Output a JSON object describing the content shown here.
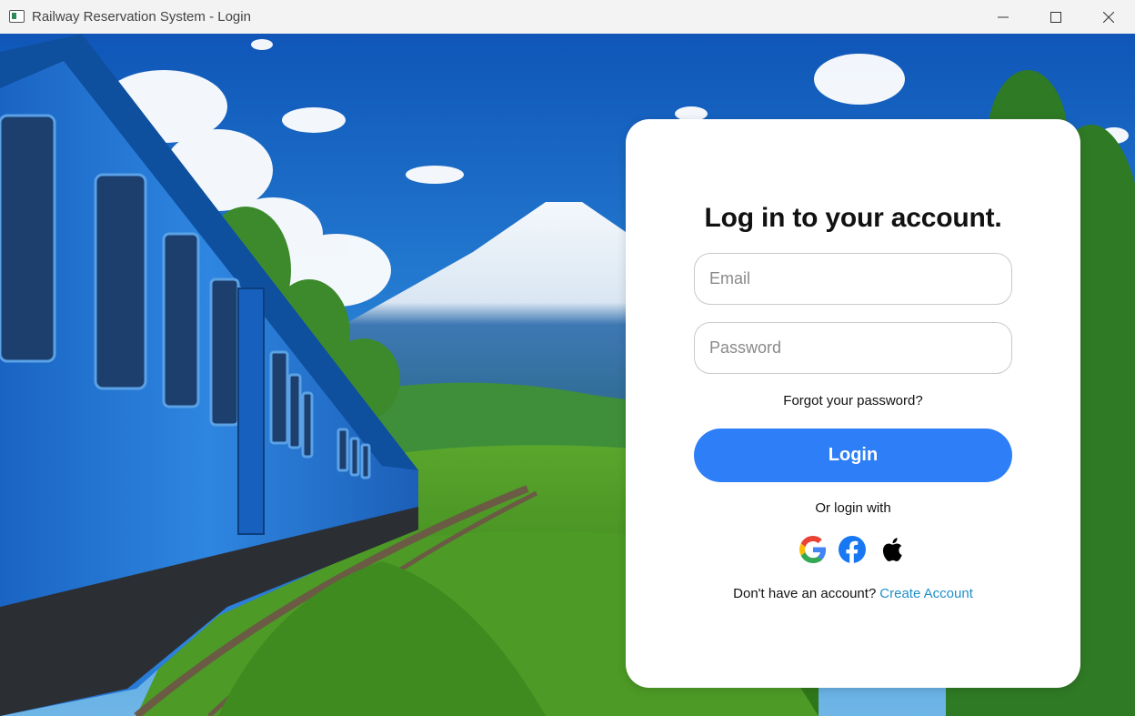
{
  "window": {
    "title": "Railway Reservation System - Login",
    "icons": [
      "app-icon",
      "minimize-icon",
      "maximize-icon",
      "close-icon"
    ]
  },
  "login": {
    "heading": "Log in to your account.",
    "email_placeholder": "Email",
    "password_placeholder": "Password",
    "forgot_label": "Forgot your password?",
    "login_button": "Login",
    "or_login_with": "Or login with",
    "social_icons": [
      "google-icon",
      "facebook-icon",
      "apple-icon"
    ],
    "no_account_text": "Don't have an account?",
    "create_account_link": "Create Account"
  },
  "colors": {
    "accent": "#2d7ef7",
    "link": "#1e8fc9"
  }
}
